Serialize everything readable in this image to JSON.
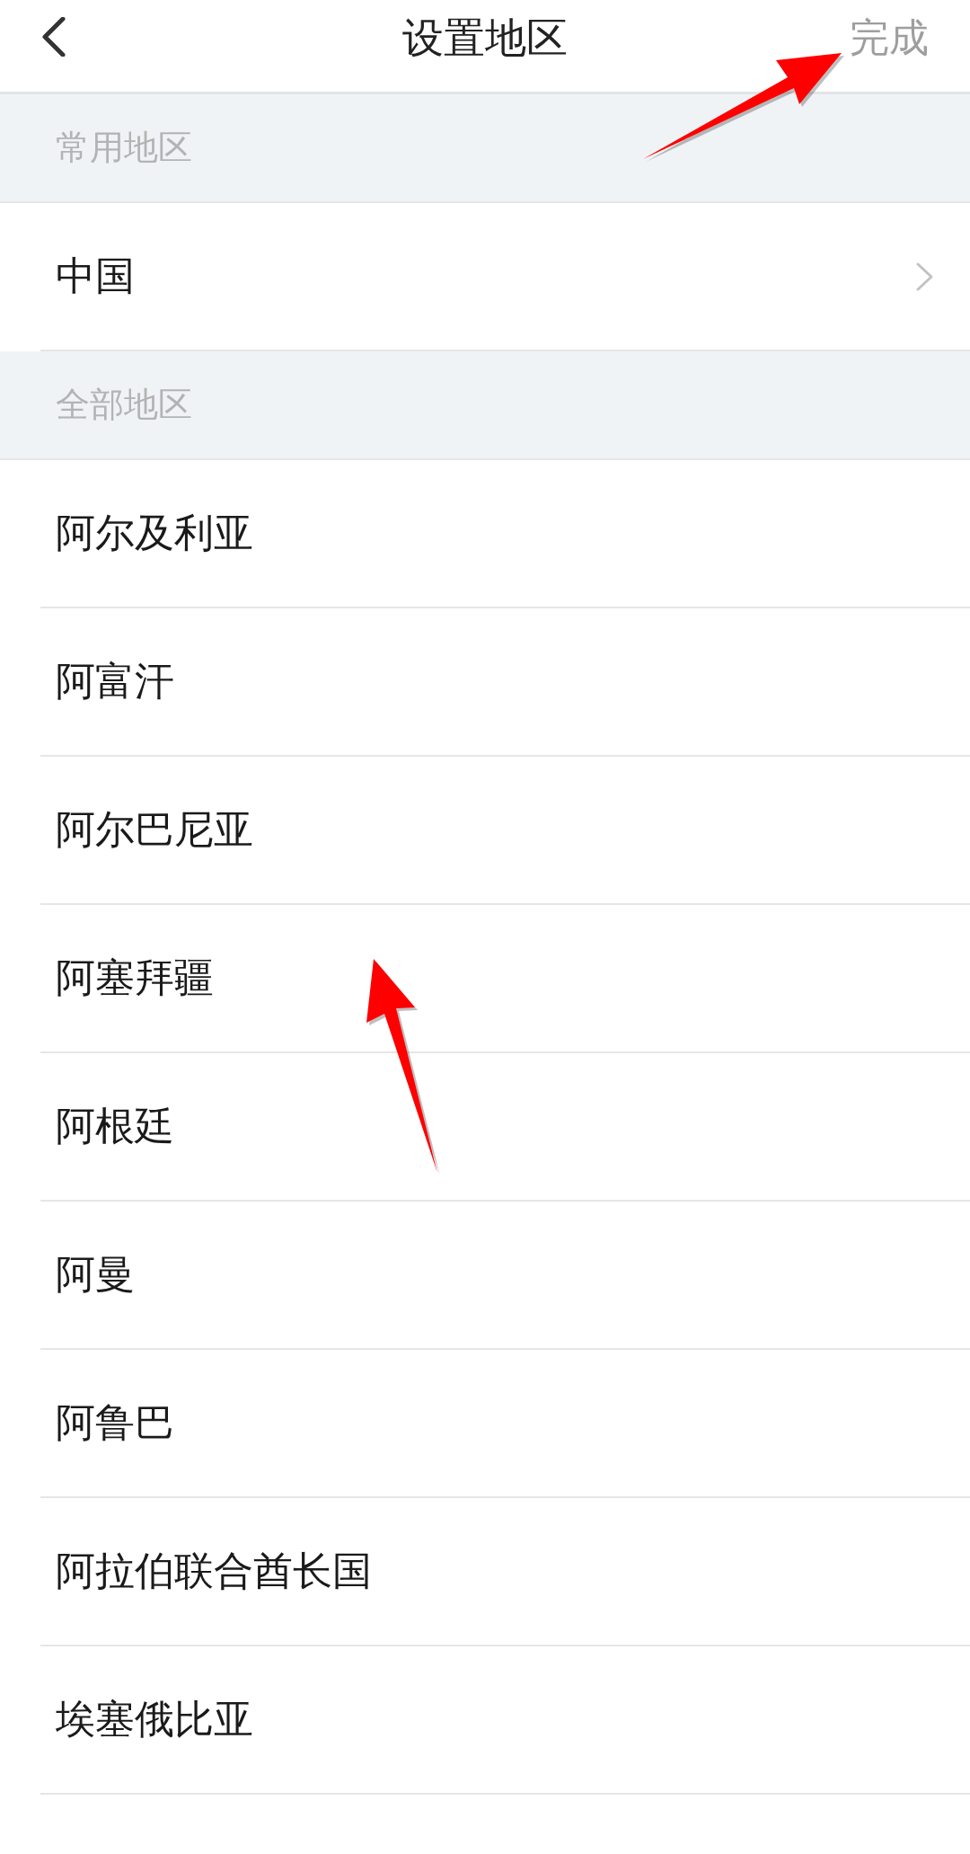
{
  "nav_bar": {
    "title": "设置地区",
    "done_button": {
      "label": "完成",
      "disabled": true
    }
  },
  "sections": [
    {
      "header": "常用地区",
      "items": [
        {
          "name": "中国",
          "kind": "submenu"
        }
      ]
    },
    {
      "header": "全部地区",
      "items": [
        {
          "name": "阿尔及利亚",
          "kind": "plain"
        },
        {
          "name": "阿富汗",
          "kind": "plain"
        },
        {
          "name": "阿尔巴尼亚",
          "kind": "plain"
        },
        {
          "name": "阿塞拜疆",
          "kind": "plain"
        },
        {
          "name": "阿根廷",
          "kind": "plain"
        },
        {
          "name": "阿曼",
          "kind": "plain"
        },
        {
          "name": "阿鲁巴",
          "kind": "plain"
        },
        {
          "name": "阿拉伯联合酋长国",
          "kind": "plain"
        },
        {
          "name": "埃塞俄比亚",
          "kind": "plain"
        }
      ]
    }
  ]
}
